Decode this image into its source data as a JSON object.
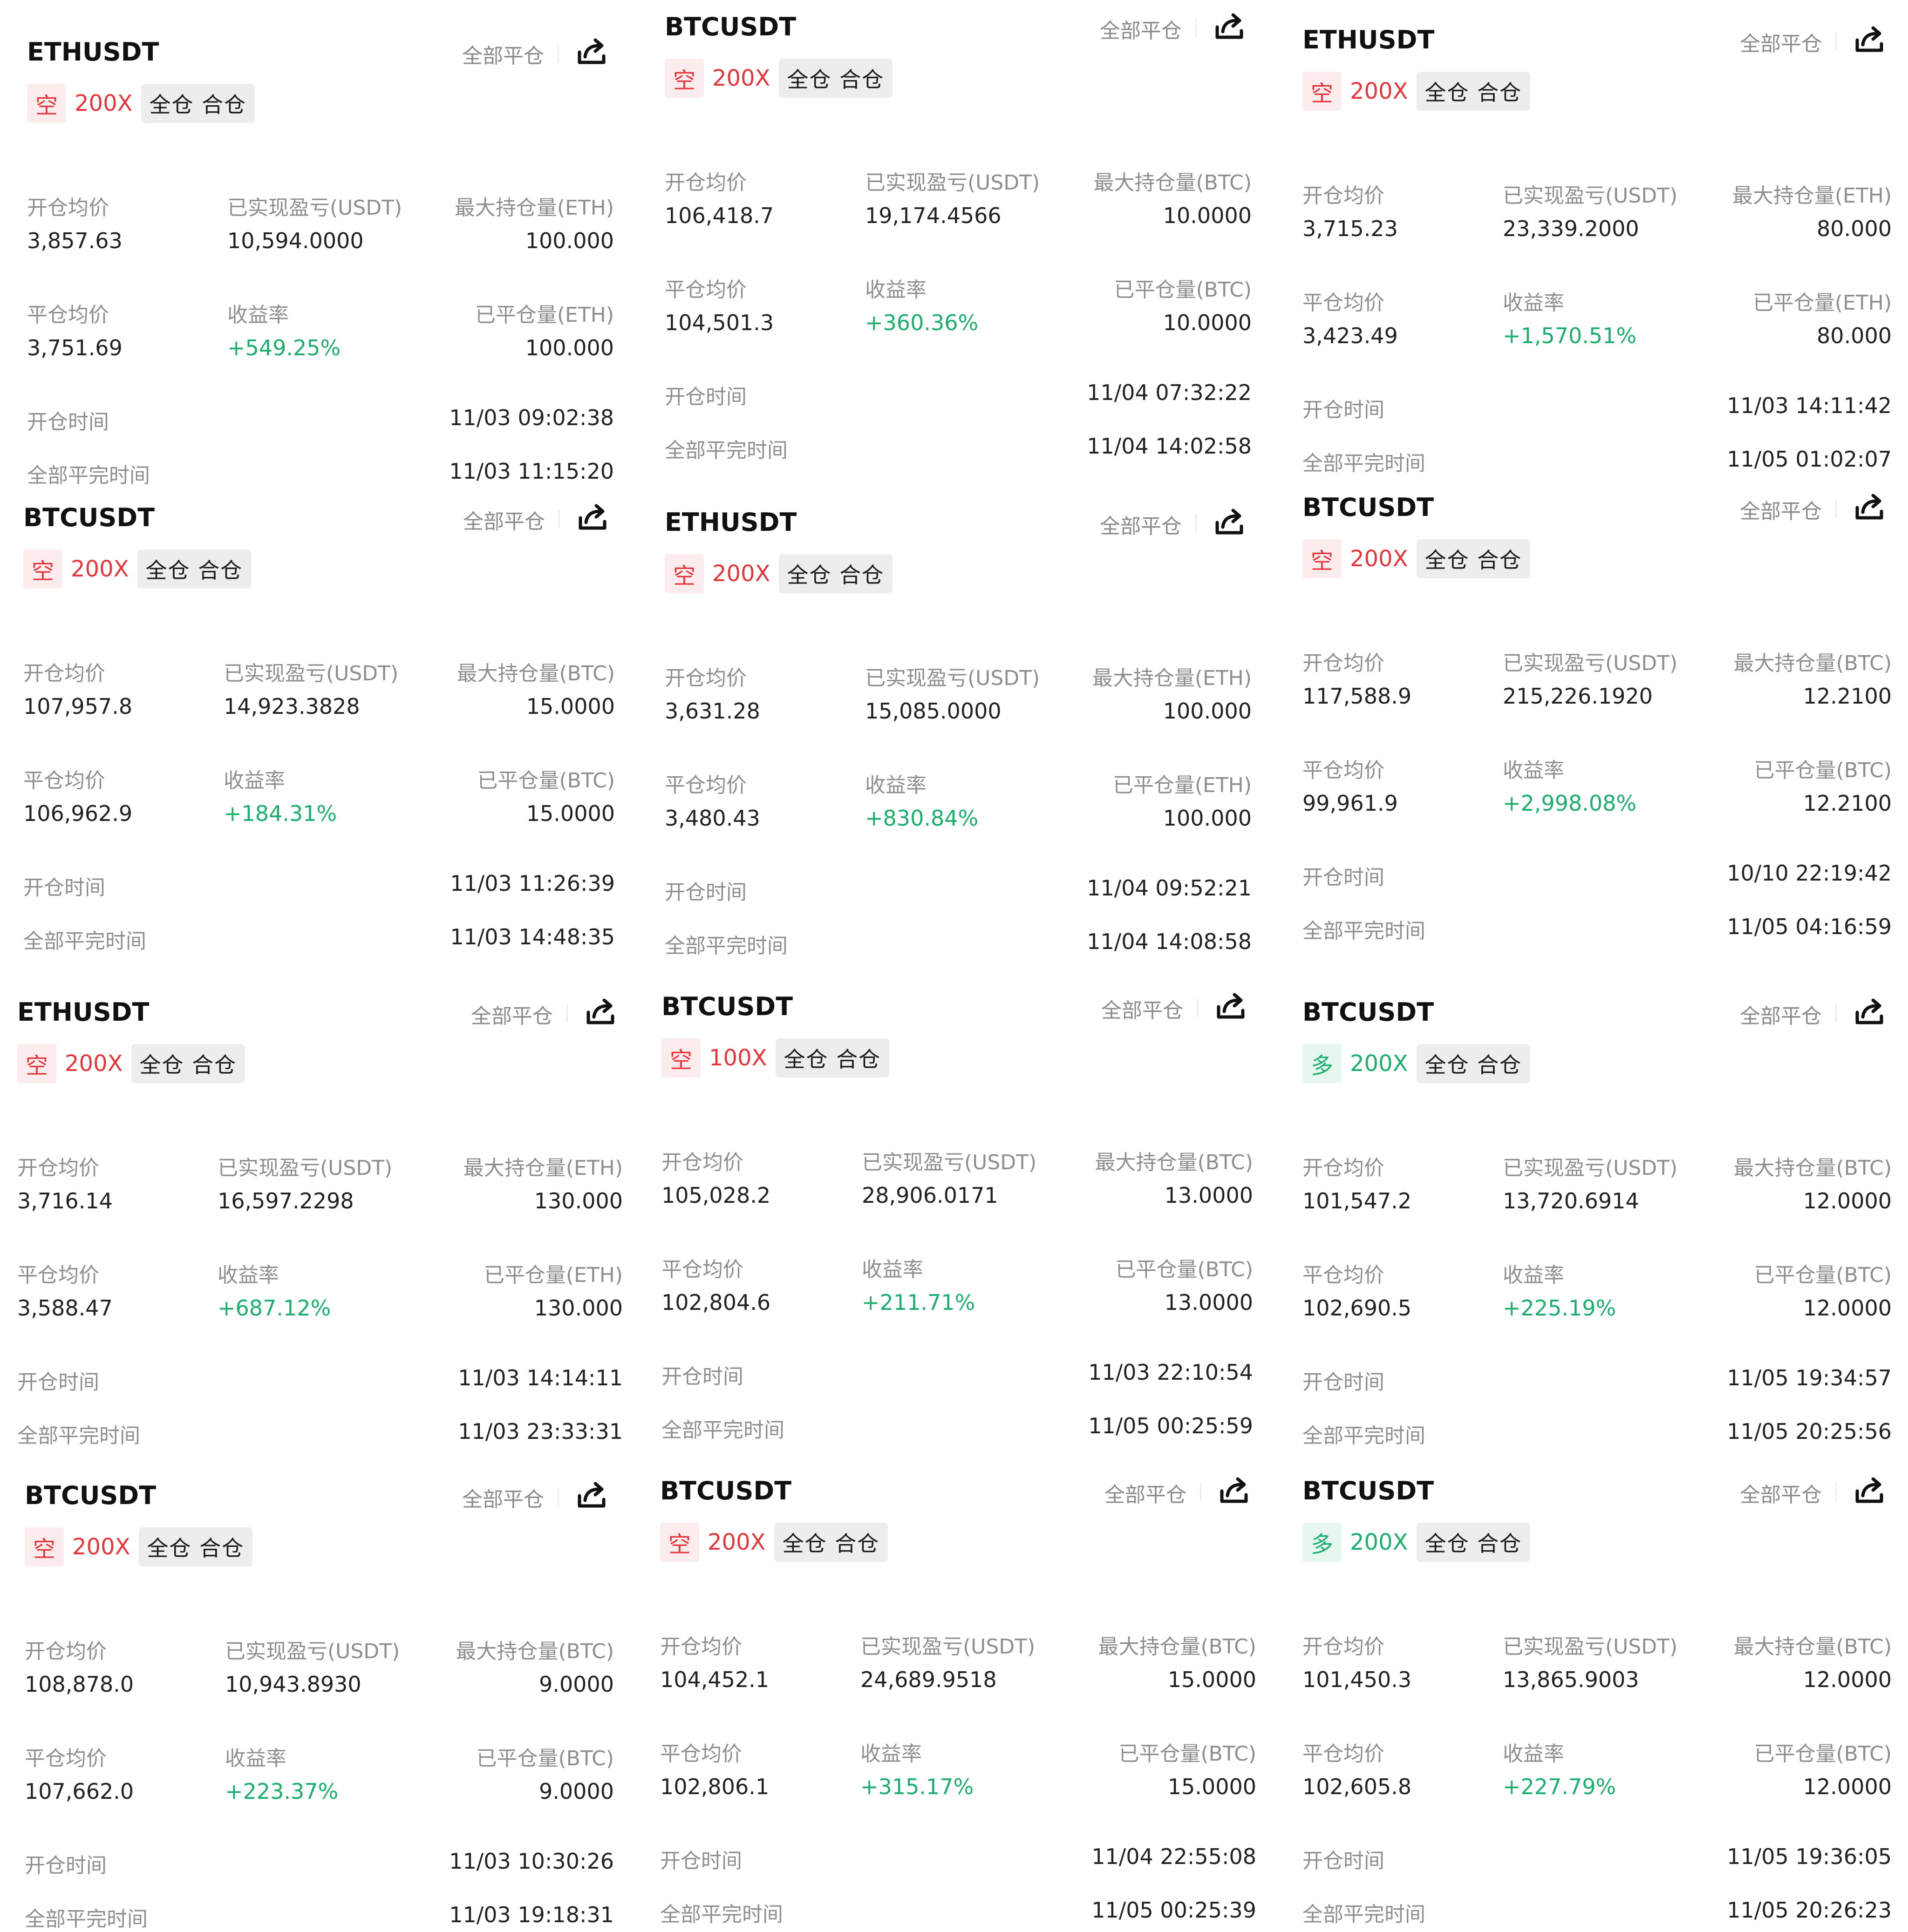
{
  "labels": {
    "close_all": "全部平仓",
    "open_avg": "开仓均价",
    "realized_pnl": "已实现盈亏(USDT)",
    "close_avg": "平仓均价",
    "roi": "收益率",
    "open_time": "开仓时间",
    "full_close_time": "全部平完时间",
    "mode": "全仓 合仓"
  },
  "icons": {
    "share": "share-icon"
  },
  "colors": {
    "short": "#e3373c",
    "long": "#1bae6c",
    "gain": "#1bae6c"
  },
  "cards": [
    {
      "symbol": "ETHUSDT",
      "side": "空",
      "side_type": "short",
      "leverage": "200X",
      "max_label": "最大持仓量(ETH)",
      "closed_label": "已平仓量(ETH)",
      "open_avg": "3,857.63",
      "realized_pnl": "10,594.0000",
      "max_pos": "100.000",
      "close_avg": "3,751.69",
      "roi": "+549.25%",
      "closed_qty": "100.000",
      "open_time": "11/03 09:02:38",
      "close_time": "11/03 11:15:20"
    },
    {
      "symbol": "BTCUSDT",
      "side": "空",
      "side_type": "short",
      "leverage": "200X",
      "max_label": "最大持仓量(BTC)",
      "closed_label": "已平仓量(BTC)",
      "open_avg": "106,418.7",
      "realized_pnl": "19,174.4566",
      "max_pos": "10.0000",
      "close_avg": "104,501.3",
      "roi": "+360.36%",
      "closed_qty": "10.0000",
      "open_time": "11/04 07:32:22",
      "close_time": "11/04 14:02:58"
    },
    {
      "symbol": "ETHUSDT",
      "side": "空",
      "side_type": "short",
      "leverage": "200X",
      "max_label": "最大持仓量(ETH)",
      "closed_label": "已平仓量(ETH)",
      "open_avg": "3,715.23",
      "realized_pnl": "23,339.2000",
      "max_pos": "80.000",
      "close_avg": "3,423.49",
      "roi": "+1,570.51%",
      "closed_qty": "80.000",
      "open_time": "11/03 14:11:42",
      "close_time": "11/05 01:02:07"
    },
    {
      "symbol": "BTCUSDT",
      "side": "空",
      "side_type": "short",
      "leverage": "200X",
      "max_label": "最大持仓量(BTC)",
      "closed_label": "已平仓量(BTC)",
      "open_avg": "107,957.8",
      "realized_pnl": "14,923.3828",
      "max_pos": "15.0000",
      "close_avg": "106,962.9",
      "roi": "+184.31%",
      "closed_qty": "15.0000",
      "open_time": "11/03 11:26:39",
      "close_time": "11/03 14:48:35"
    },
    {
      "symbol": "ETHUSDT",
      "side": "空",
      "side_type": "short",
      "leverage": "200X",
      "max_label": "最大持仓量(ETH)",
      "closed_label": "已平仓量(ETH)",
      "open_avg": "3,631.28",
      "realized_pnl": "15,085.0000",
      "max_pos": "100.000",
      "close_avg": "3,480.43",
      "roi": "+830.84%",
      "closed_qty": "100.000",
      "open_time": "11/04 09:52:21",
      "close_time": "11/04 14:08:58"
    },
    {
      "symbol": "BTCUSDT",
      "side": "空",
      "side_type": "short",
      "leverage": "200X",
      "max_label": "最大持仓量(BTC)",
      "closed_label": "已平仓量(BTC)",
      "open_avg": "117,588.9",
      "realized_pnl": "215,226.1920",
      "max_pos": "12.2100",
      "close_avg": "99,961.9",
      "roi": "+2,998.08%",
      "closed_qty": "12.2100",
      "open_time": "10/10 22:19:42",
      "close_time": "11/05 04:16:59"
    },
    {
      "symbol": "ETHUSDT",
      "side": "空",
      "side_type": "short",
      "leverage": "200X",
      "max_label": "最大持仓量(ETH)",
      "closed_label": "已平仓量(ETH)",
      "open_avg": "3,716.14",
      "realized_pnl": "16,597.2298",
      "max_pos": "130.000",
      "close_avg": "3,588.47",
      "roi": "+687.12%",
      "closed_qty": "130.000",
      "open_time": "11/03 14:14:11",
      "close_time": "11/03 23:33:31"
    },
    {
      "symbol": "BTCUSDT",
      "side": "空",
      "side_type": "short",
      "leverage": "100X",
      "max_label": "最大持仓量(BTC)",
      "closed_label": "已平仓量(BTC)",
      "open_avg": "105,028.2",
      "realized_pnl": "28,906.0171",
      "max_pos": "13.0000",
      "close_avg": "102,804.6",
      "roi": "+211.71%",
      "closed_qty": "13.0000",
      "open_time": "11/03 22:10:54",
      "close_time": "11/05 00:25:59"
    },
    {
      "symbol": "BTCUSDT",
      "side": "多",
      "side_type": "long",
      "leverage": "200X",
      "max_label": "最大持仓量(BTC)",
      "closed_label": "已平仓量(BTC)",
      "open_avg": "101,547.2",
      "realized_pnl": "13,720.6914",
      "max_pos": "12.0000",
      "close_avg": "102,690.5",
      "roi": "+225.19%",
      "closed_qty": "12.0000",
      "open_time": "11/05 19:34:57",
      "close_time": "11/05 20:25:56"
    },
    {
      "symbol": "BTCUSDT",
      "side": "空",
      "side_type": "short",
      "leverage": "200X",
      "max_label": "最大持仓量(BTC)",
      "closed_label": "已平仓量(BTC)",
      "open_avg": "108,878.0",
      "realized_pnl": "10,943.8930",
      "max_pos": "9.0000",
      "close_avg": "107,662.0",
      "roi": "+223.37%",
      "closed_qty": "9.0000",
      "open_time": "11/03 10:30:26",
      "close_time": "11/03 19:18:31"
    },
    {
      "symbol": "BTCUSDT",
      "side": "空",
      "side_type": "short",
      "leverage": "200X",
      "max_label": "最大持仓量(BTC)",
      "closed_label": "已平仓量(BTC)",
      "open_avg": "104,452.1",
      "realized_pnl": "24,689.9518",
      "max_pos": "15.0000",
      "close_avg": "102,806.1",
      "roi": "+315.17%",
      "closed_qty": "15.0000",
      "open_time": "11/04 22:55:08",
      "close_time": "11/05 00:25:39"
    },
    {
      "symbol": "BTCUSDT",
      "side": "多",
      "side_type": "long",
      "leverage": "200X",
      "max_label": "最大持仓量(BTC)",
      "closed_label": "已平仓量(BTC)",
      "open_avg": "101,450.3",
      "realized_pnl": "13,865.9003",
      "max_pos": "12.0000",
      "close_avg": "102,605.8",
      "roi": "+227.79%",
      "closed_qty": "12.0000",
      "open_time": "11/05 19:36:05",
      "close_time": "11/05 20:26:23"
    }
  ]
}
